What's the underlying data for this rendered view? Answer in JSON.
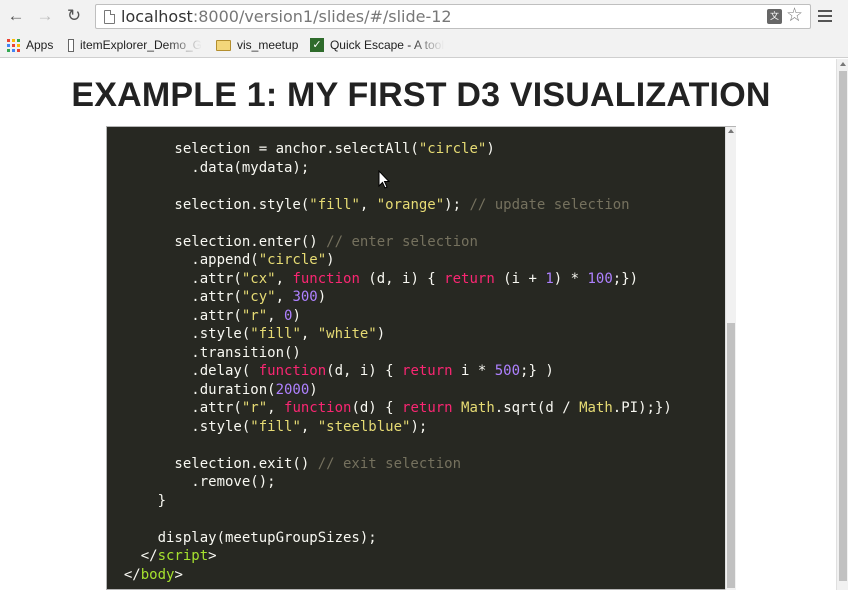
{
  "browser": {
    "url_host": "localhost",
    "url_path": ":8000/version1/slides/#/slide-12",
    "bookmarks": [
      {
        "label": "Apps",
        "icon": "apps-grid-icon"
      },
      {
        "label": "itemExplorer_Demo_G",
        "icon": "page-icon"
      },
      {
        "label": "vis_meetup",
        "icon": "folder-icon"
      },
      {
        "label": "Quick Escape - A tool",
        "icon": "quick-escape-icon"
      }
    ],
    "icons": {
      "back": "←",
      "forward": "→",
      "reload": "↻",
      "star": "☆",
      "translate": "文"
    }
  },
  "slide": {
    "title": "EXAMPLE 1: MY FIRST D3 VISUALIZATION",
    "code_lines": [
      [
        {
          "t": "        selection = anchor.selectAll("
        },
        {
          "t": "\"circle\"",
          "c": "s"
        },
        {
          "t": ")"
        }
      ],
      [
        {
          "t": "          .data(mydata);"
        }
      ],
      [
        {
          "t": ""
        }
      ],
      [
        {
          "t": "        selection.style("
        },
        {
          "t": "\"fill\"",
          "c": "s"
        },
        {
          "t": ", "
        },
        {
          "t": "\"orange\"",
          "c": "s"
        },
        {
          "t": "); "
        },
        {
          "t": "// update selection",
          "c": "c"
        }
      ],
      [
        {
          "t": ""
        }
      ],
      [
        {
          "t": "        selection.enter() "
        },
        {
          "t": "// enter selection",
          "c": "c"
        }
      ],
      [
        {
          "t": "          .append("
        },
        {
          "t": "\"circle\"",
          "c": "s"
        },
        {
          "t": ")"
        }
      ],
      [
        {
          "t": "          .attr("
        },
        {
          "t": "\"cx\"",
          "c": "s"
        },
        {
          "t": ", "
        },
        {
          "t": "function",
          "c": "k"
        },
        {
          "t": " (d, i) { "
        },
        {
          "t": "return",
          "c": "k"
        },
        {
          "t": " (i + "
        },
        {
          "t": "1",
          "c": "n"
        },
        {
          "t": ") * "
        },
        {
          "t": "100",
          "c": "n"
        },
        {
          "t": ";})"
        }
      ],
      [
        {
          "t": "          .attr("
        },
        {
          "t": "\"cy\"",
          "c": "s"
        },
        {
          "t": ", "
        },
        {
          "t": "300",
          "c": "n"
        },
        {
          "t": ")"
        }
      ],
      [
        {
          "t": "          .attr("
        },
        {
          "t": "\"r\"",
          "c": "s"
        },
        {
          "t": ", "
        },
        {
          "t": "0",
          "c": "n"
        },
        {
          "t": ")"
        }
      ],
      [
        {
          "t": "          .style("
        },
        {
          "t": "\"fill\"",
          "c": "s"
        },
        {
          "t": ", "
        },
        {
          "t": "\"white\"",
          "c": "s"
        },
        {
          "t": ")"
        }
      ],
      [
        {
          "t": "          .transition()"
        }
      ],
      [
        {
          "t": "          .delay( "
        },
        {
          "t": "function",
          "c": "k"
        },
        {
          "t": "(d, i) { "
        },
        {
          "t": "return",
          "c": "k"
        },
        {
          "t": " i * "
        },
        {
          "t": "500",
          "c": "n"
        },
        {
          "t": ";} )"
        }
      ],
      [
        {
          "t": "          .duration("
        },
        {
          "t": "2000",
          "c": "n"
        },
        {
          "t": ")"
        }
      ],
      [
        {
          "t": "          .attr("
        },
        {
          "t": "\"r\"",
          "c": "s"
        },
        {
          "t": ", "
        },
        {
          "t": "function",
          "c": "k"
        },
        {
          "t": "(d) { "
        },
        {
          "t": "return",
          "c": "k"
        },
        {
          "t": " "
        },
        {
          "t": "Math",
          "c": "s"
        },
        {
          "t": ".sqrt(d / "
        },
        {
          "t": "Math",
          "c": "s"
        },
        {
          "t": ".PI);})"
        }
      ],
      [
        {
          "t": "          .style("
        },
        {
          "t": "\"fill\"",
          "c": "s"
        },
        {
          "t": ", "
        },
        {
          "t": "\"steelblue\"",
          "c": "s"
        },
        {
          "t": ");"
        }
      ],
      [
        {
          "t": ""
        }
      ],
      [
        {
          "t": "        selection.exit() "
        },
        {
          "t": "// exit selection",
          "c": "c"
        }
      ],
      [
        {
          "t": "          .remove();"
        }
      ],
      [
        {
          "t": "      }"
        }
      ],
      [
        {
          "t": ""
        }
      ],
      [
        {
          "t": "      display(meetupGroupSizes);"
        }
      ],
      [
        {
          "t": "    </"
        },
        {
          "t": "script",
          "c": "t"
        },
        {
          "t": ">"
        }
      ],
      [
        {
          "t": "  </"
        },
        {
          "t": "body",
          "c": "t"
        },
        {
          "t": ">"
        }
      ]
    ]
  },
  "colors": {
    "code_bg": "#272822",
    "string": "#e6db74",
    "comment": "#75715e",
    "keyword": "#f92672",
    "number": "#ae81ff",
    "tag": "#a6e22e"
  }
}
